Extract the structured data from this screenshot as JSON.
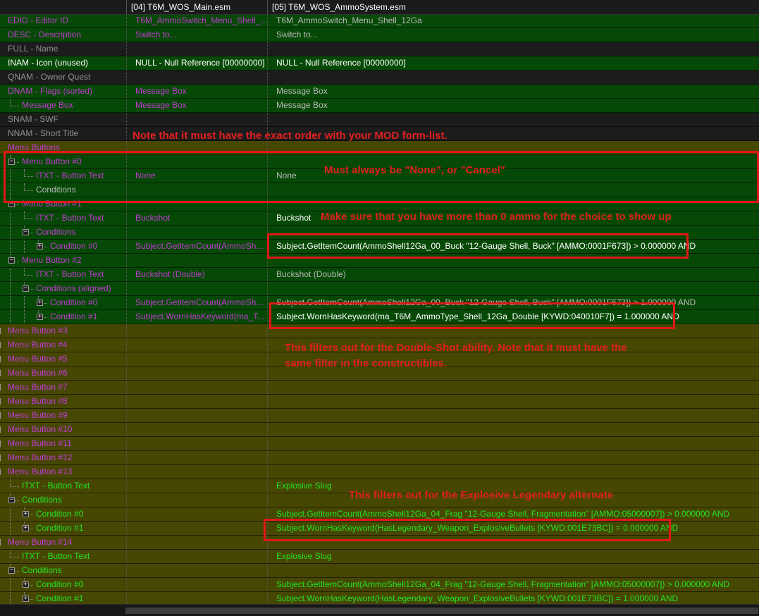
{
  "columns": [
    "",
    "[04] T6M_WOS_Main.esm",
    "[05] T6M_WOS_AmmoSystem.esm"
  ],
  "rows": [
    {
      "label": "EDID - Editor ID",
      "v1": "T6M_AmmoSwitch_Menu_Shell_...",
      "v2": "T6M_AmmoSwitch_Menu_Shell_12Ga",
      "bg": "g",
      "lc": "cm",
      "c1": "cm",
      "c2": "cd",
      "d": 0
    },
    {
      "label": "DESC - Description",
      "v1": "Switch to...",
      "v2": "Switch to...",
      "bg": "g",
      "lc": "cm",
      "c1": "cm",
      "c2": "cd",
      "d": 0
    },
    {
      "label": "FULL - Name",
      "v1": "",
      "v2": "",
      "bg": "d",
      "lc": "cs",
      "c1": "cd",
      "c2": "cd",
      "d": 0
    },
    {
      "label": "INAM - Icon (unused)",
      "v1": "NULL - Null Reference [00000000]",
      "v2": "NULL - Null Reference [00000000]",
      "bg": "g",
      "lc": "cw",
      "c1": "cw",
      "c2": "cw",
      "d": 0
    },
    {
      "label": "QNAM - Owner Quest",
      "v1": "",
      "v2": "",
      "bg": "d",
      "lc": "cs",
      "c1": "cd",
      "c2": "cd",
      "d": 0
    },
    {
      "label": "DNAM - Flags (sorted)",
      "v1": "Message Box",
      "v2": "Message Box",
      "bg": "g",
      "lc": "cm",
      "c1": "cm",
      "c2": "cd",
      "d": 0
    },
    {
      "label": "Message Box",
      "v1": "Message Box",
      "v2": "Message Box",
      "bg": "g",
      "lc": "cm",
      "c1": "cm",
      "c2": "cd",
      "d": 1
    },
    {
      "label": "SNAM - SWF",
      "v1": "",
      "v2": "",
      "bg": "d",
      "lc": "cs",
      "c1": "cd",
      "c2": "cd",
      "d": 0
    },
    {
      "label": "NNAM - Short Title",
      "v1": "",
      "v2": "",
      "bg": "d",
      "lc": "cs",
      "c1": "cd",
      "c2": "cd",
      "d": 0
    },
    {
      "label": "Menu Buttons",
      "v1": "",
      "v2": "",
      "bg": "o",
      "lc": "cm",
      "c1": "cd",
      "c2": "cd",
      "d": 0
    },
    {
      "label": "Menu Button #0",
      "v1": "",
      "v2": "",
      "bg": "g",
      "lc": "cm",
      "c1": "cd",
      "c2": "cd",
      "d": 1,
      "tog": "−"
    },
    {
      "label": "ITXT - Button Text",
      "v1": "None",
      "v2": "None",
      "bg": "g",
      "lc": "cm",
      "c1": "cm",
      "c2": "cd",
      "d": 2
    },
    {
      "label": "Conditions",
      "v1": "",
      "v2": "",
      "bg": "g",
      "lc": "cd",
      "c1": "cd",
      "c2": "cd",
      "d": 2
    },
    {
      "label": "Menu Button #1",
      "v1": "",
      "v2": "",
      "bg": "g",
      "lc": "cm",
      "c1": "cd",
      "c2": "cd",
      "d": 1,
      "tog": "−"
    },
    {
      "label": "ITXT - Button Text",
      "v1": "Buckshot",
      "v2": "Buckshot",
      "bg": "g",
      "lc": "cm",
      "c1": "cm",
      "c2": "cw",
      "d": 2
    },
    {
      "label": "Conditions",
      "v1": "",
      "v2": "",
      "bg": "g",
      "lc": "cm",
      "c1": "cd",
      "c2": "cd",
      "d": 2,
      "tog": "−"
    },
    {
      "label": "Condition #0",
      "v1": "Subject.GetItemCount(AmmoSh...",
      "v2": "Subject.GetItemCount(AmmoShell12Ga_00_Buck \"12-Gauge Shell, Buck\" [AMMO:0001F673]) > 0.000000 AND",
      "bg": "g",
      "lc": "cm",
      "c1": "cm",
      "c2": "cw",
      "d": 3,
      "tog": "+"
    },
    {
      "label": "Menu Button #2",
      "v1": "",
      "v2": "",
      "bg": "g",
      "lc": "cm",
      "c1": "cd",
      "c2": "cd",
      "d": 1,
      "tog": "−"
    },
    {
      "label": "ITXT - Button Text",
      "v1": "Buckshot (Double)",
      "v2": "Buckshot (Double)",
      "bg": "g",
      "lc": "cm",
      "c1": "cm",
      "c2": "cd",
      "d": 2
    },
    {
      "label": "Conditions (aligned)",
      "v1": "",
      "v2": "",
      "bg": "g",
      "lc": "cm",
      "c1": "cd",
      "c2": "cd",
      "d": 2,
      "tog": "−"
    },
    {
      "label": "Condition #0",
      "v1": "Subject.GetItemCount(AmmoSh...",
      "v2": "Subject.GetItemCount(AmmoShell12Ga_00_Buck \"12-Gauge Shell, Buck\" [AMMO:0001F673]) > 1.000000 AND",
      "bg": "g",
      "lc": "cm",
      "c1": "cm",
      "c2": "cd",
      "d": 3,
      "tog": "+"
    },
    {
      "label": "Condition #1",
      "v1": "Subject.WornHasKeyword(ma_T...",
      "v2": "Subject.WornHasKeyword(ma_T6M_AmmoType_Shell_12Ga_Double [KYWD:040010F7]) = 1.000000 AND",
      "bg": "g",
      "lc": "cm",
      "c1": "cm",
      "c2": "cw",
      "d": 3,
      "tog": "+"
    },
    {
      "label": "Menu Button #3",
      "v1": "",
      "v2": "",
      "bg": "o",
      "lc": "cm",
      "c1": "cd",
      "c2": "cd",
      "d": 0,
      "tog": "+"
    },
    {
      "label": "Menu Button #4",
      "v1": "",
      "v2": "",
      "bg": "o",
      "lc": "cm",
      "c1": "cd",
      "c2": "cd",
      "d": 0,
      "tog": "+"
    },
    {
      "label": "Menu Button #5",
      "v1": "",
      "v2": "",
      "bg": "o",
      "lc": "cm",
      "c1": "cd",
      "c2": "cd",
      "d": 0,
      "tog": "+"
    },
    {
      "label": "Menu Button #6",
      "v1": "",
      "v2": "",
      "bg": "o",
      "lc": "cm",
      "c1": "cd",
      "c2": "cd",
      "d": 0,
      "tog": "+"
    },
    {
      "label": "Menu Button #7",
      "v1": "",
      "v2": "",
      "bg": "o",
      "lc": "cm",
      "c1": "cd",
      "c2": "cd",
      "d": 0,
      "tog": "+"
    },
    {
      "label": "Menu Button #8",
      "v1": "",
      "v2": "",
      "bg": "o",
      "lc": "cm",
      "c1": "cd",
      "c2": "cd",
      "d": 0,
      "tog": "+"
    },
    {
      "label": "Menu Button #9",
      "v1": "",
      "v2": "",
      "bg": "o",
      "lc": "cm",
      "c1": "cd",
      "c2": "cd",
      "d": 0,
      "tog": "+"
    },
    {
      "label": "Menu Button #10",
      "v1": "",
      "v2": "",
      "bg": "o",
      "lc": "cm",
      "c1": "cd",
      "c2": "cd",
      "d": 0,
      "tog": "+"
    },
    {
      "label": "Menu Button #11",
      "v1": "",
      "v2": "",
      "bg": "o",
      "lc": "cm",
      "c1": "cd",
      "c2": "cd",
      "d": 0,
      "tog": "+"
    },
    {
      "label": "Menu Button #12",
      "v1": "",
      "v2": "",
      "bg": "o",
      "lc": "cm",
      "c1": "cd",
      "c2": "cd",
      "d": 0,
      "tog": "+"
    },
    {
      "label": "Menu Button #13",
      "v1": "",
      "v2": "",
      "bg": "o",
      "lc": "cm",
      "c1": "cd",
      "c2": "cd",
      "d": 0,
      "tog": "−"
    },
    {
      "label": "ITXT - Button Text",
      "v1": "",
      "v2": "Explosive Slug",
      "bg": "o",
      "lc": "cl",
      "c1": "cd",
      "c2": "cl",
      "d": 1
    },
    {
      "label": "Conditions",
      "v1": "",
      "v2": "",
      "bg": "o",
      "lc": "cl",
      "c1": "cd",
      "c2": "cd",
      "d": 1,
      "tog": "−"
    },
    {
      "label": "Condition #0",
      "v1": "",
      "v2": "Subject.GetItemCount(AmmoShell12Ga_04_Frag \"12-Gauge Shell, Fragmentation\" [AMMO:05000007]) > 0.000000 AND",
      "bg": "o",
      "lc": "cl",
      "c1": "cd",
      "c2": "cl",
      "d": 2,
      "tog": "+"
    },
    {
      "label": "Condition #1",
      "v1": "",
      "v2": "Subject.WornHasKeyword(HasLegendary_Weapon_ExplosiveBullets [KYWD:001E73BC]) = 0.000000 AND",
      "bg": "o",
      "lc": "cl",
      "c1": "cd",
      "c2": "cl",
      "d": 2,
      "tog": "+"
    },
    {
      "label": "Menu Button #14",
      "v1": "",
      "v2": "",
      "bg": "o",
      "lc": "cm",
      "c1": "cd",
      "c2": "cd",
      "d": 0,
      "tog": "−"
    },
    {
      "label": "ITXT - Button Text",
      "v1": "",
      "v2": "Explosive Slug",
      "bg": "o",
      "lc": "cl",
      "c1": "cd",
      "c2": "cl",
      "d": 1
    },
    {
      "label": "Conditions",
      "v1": "",
      "v2": "",
      "bg": "o",
      "lc": "cl",
      "c1": "cd",
      "c2": "cd",
      "d": 1,
      "tog": "−"
    },
    {
      "label": "Condition #0",
      "v1": "",
      "v2": "Subject.GetItemCount(AmmoShell12Ga_04_Frag \"12-Gauge Shell, Fragmentation\" [AMMO:05000007]) > 0.000000 AND",
      "bg": "o",
      "lc": "cl",
      "c1": "cd",
      "c2": "cl",
      "d": 2,
      "tog": "+"
    },
    {
      "label": "Condition #1",
      "v1": "",
      "v2": "Subject.WornHasKeyword(HasLegendary_Weapon_ExplosiveBullets [KYWD:001E73BC]) = 1.000000 AND",
      "bg": "o",
      "lc": "cl",
      "c1": "cd",
      "c2": "cl",
      "d": 2,
      "tog": "+"
    }
  ],
  "annotations": {
    "order_note": "Note that it must have the exact order with your MOD form-list.",
    "none_note": "Must always be \"None\", or \"Cancel\"",
    "ammo_note": "Make sure that you have more than 0 ammo for the choice to show up",
    "double_note_line1": "This filters out for the Double-Shot ability. Note that it must have the",
    "double_note_line2": "same filter in the constructibles.",
    "explosive_note": "This filters out for the Explosive Legendary alternate"
  },
  "colors": {
    "green_row": "#064906",
    "olive_row": "#474704",
    "dark_row": "#1c1c1c",
    "magenta_text": "#c03ad0",
    "lime_text": "#23e423",
    "annotation_red": "#e02020"
  }
}
